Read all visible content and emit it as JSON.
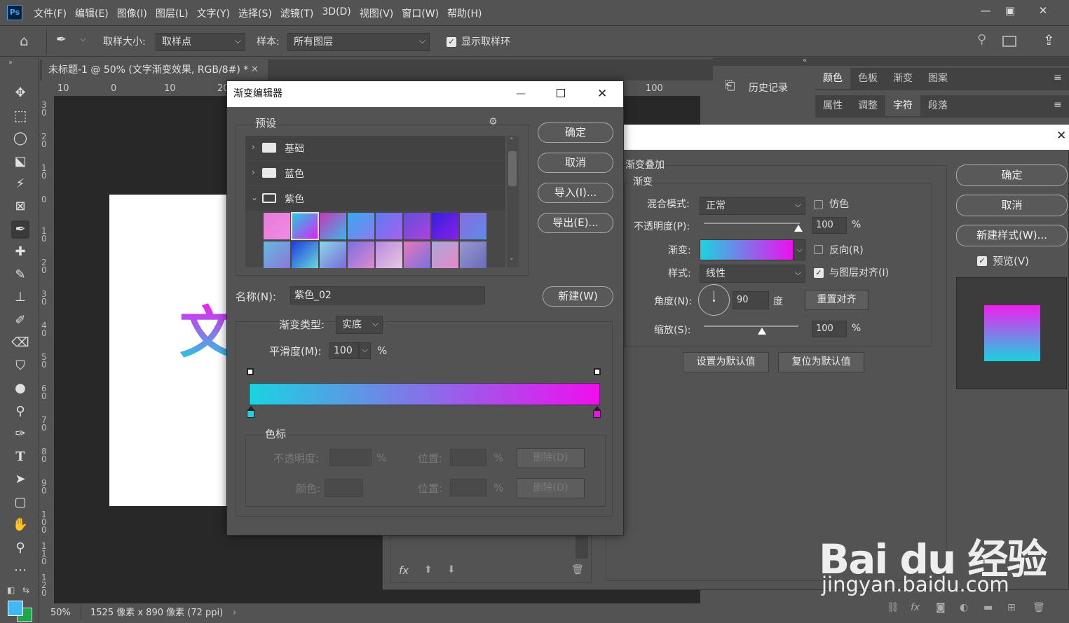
{
  "app": {
    "logo": "Ps",
    "menu": [
      "文件(F)",
      "编辑(E)",
      "图像(I)",
      "图层(L)",
      "文字(Y)",
      "选择(S)",
      "滤镜(T)",
      "3D(D)",
      "视图(V)",
      "窗口(W)",
      "帮助(H)"
    ]
  },
  "options": {
    "sample_size_label": "取样大小:",
    "sample_size_value": "取样点",
    "sample_label": "样本:",
    "sample_value": "所有图层",
    "show_ring_label": "显示取样环"
  },
  "document": {
    "tab_title": "未标题-1 @ 50% (文字渐变效果, RGB/8#) *",
    "ruler_top": [
      "10",
      "0",
      "10",
      "20"
    ],
    "ruler_right_label": "100",
    "ruler_left": [
      "3\n0",
      "2\n0",
      "1\n0",
      "0",
      "1\n0",
      "2\n0",
      "3\n0",
      "4\n0",
      "5\n0",
      "6\n0",
      "7\n0",
      "8\n0",
      "9\n0",
      "1\n0\n0",
      "1\n1\n0",
      "1\n2\n0"
    ],
    "canvas_char": "文",
    "zoom": "50%",
    "size_info": "1525 像素 x 890 像素 (72 ppi)"
  },
  "panels": {
    "history_label": "历史记录",
    "tabs_row1": [
      "颜色",
      "色板",
      "渐变",
      "图案"
    ],
    "tabs_row2": [
      "属性",
      "调整",
      "字符",
      "段落"
    ]
  },
  "layer_style": {
    "section_title": "渐变叠加",
    "subsection": "渐变",
    "blend_mode_label": "混合模式:",
    "blend_mode_value": "正常",
    "dither_label": "仿色",
    "opacity_label": "不透明度(P):",
    "opacity_value": "100",
    "opacity_level": 1.0,
    "gradient_label": "渐变:",
    "reverse_label": "反向(R)",
    "style_label": "样式:",
    "style_value": "线性",
    "align_label": "与图层对齐(I)",
    "angle_label": "角度(N):",
    "angle_value": "90",
    "degree_unit": "度",
    "reset_align_label": "重置对齐",
    "scale_label": "缩放(S):",
    "scale_value": "100",
    "percent": "%",
    "set_default_label": "设置为默认值",
    "reset_default_label": "复位为默认值",
    "ok_label": "确定",
    "cancel_label": "取消",
    "new_style_label": "新建样式(W)...",
    "preview_label": "预览(V)",
    "fx_label": "fx"
  },
  "gradient_editor": {
    "title": "渐变编辑器",
    "presets_label": "预设",
    "folders": [
      "基础",
      "蓝色",
      "紫色"
    ],
    "swatches_row1": [
      [
        "#e87ad8",
        "#f08ce4"
      ],
      [
        "#1bd0e4",
        "#e41ef0"
      ],
      [
        "#c738b8",
        "#38b8e8"
      ],
      [
        "#34a8f0",
        "#8c7cf0"
      ],
      [
        "#5a7cf0",
        "#a860f0"
      ],
      [
        "#6050d8",
        "#b040e0"
      ],
      [
        "#3420e0",
        "#8a20e8"
      ],
      [
        "#8a6ae0",
        "#5e8ce8"
      ]
    ],
    "swatches_row2": [
      [
        "#68b8e0",
        "#8878d8"
      ],
      [
        "#1c3ce0",
        "#6ad8d8"
      ],
      [
        "#88d8e8",
        "#7a6ad8"
      ],
      [
        "#7870e0",
        "#e08ad0"
      ],
      [
        "#b888e0",
        "#e8c8e0"
      ],
      [
        "#e878b8",
        "#7870e0"
      ],
      [
        "#a8a8d8",
        "#e888c8"
      ],
      [
        "#9898d0",
        "#6a6ab8"
      ]
    ],
    "ok_label": "确定",
    "cancel_label": "取消",
    "import_label": "导入(I)...",
    "export_label": "导出(E)...",
    "name_label": "名称(N):",
    "name_value": "紫色_02",
    "new_label": "新建(W)",
    "type_label": "渐变类型:",
    "type_value": "实底",
    "smooth_label": "平滑度(M):",
    "smooth_value": "100",
    "percent": "%",
    "gradient_start": "#1bd3e0",
    "gradient_end": "#f00ef0",
    "stops_label": "色标",
    "stop_opacity_label": "不透明度:",
    "stop_position_label": "位置:",
    "stop_delete_label": "删除(D)",
    "stop_color_label": "颜色:"
  },
  "watermark": {
    "text_main": "Bai du 经验",
    "text_url": "jingyan.baidu.com"
  },
  "colors": {
    "accent": "#31a8ff",
    "foreground": "#3fb8f5",
    "background": "#1ca84a"
  }
}
